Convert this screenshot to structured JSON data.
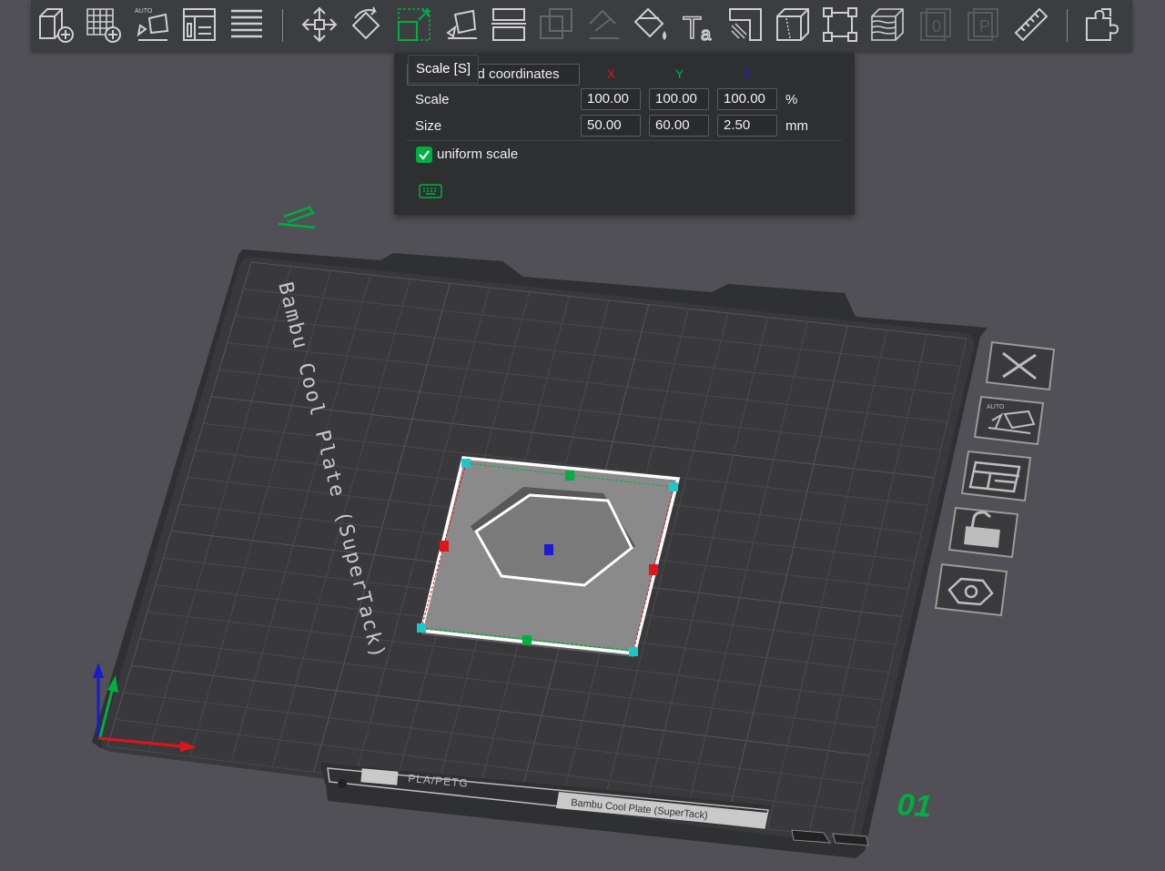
{
  "toolbar": {
    "items": [
      {
        "id": "add",
        "icon": "add-object-icon",
        "label": "Add"
      },
      {
        "id": "grid",
        "icon": "add-plate-icon",
        "label": "Add plate"
      },
      {
        "id": "auto",
        "icon": "auto-orient-icon",
        "label": "AUTO"
      },
      {
        "id": "arrange",
        "icon": "arrange-icon",
        "label": "Arrange"
      },
      {
        "id": "split",
        "icon": "split-icon",
        "label": "Split"
      },
      {
        "id": "move",
        "icon": "move-icon",
        "label": "Move"
      },
      {
        "id": "rotate",
        "icon": "rotate-icon",
        "label": "Rotate"
      },
      {
        "id": "scale",
        "icon": "scale-icon",
        "label": "Scale"
      },
      {
        "id": "lay",
        "icon": "lay-on-face-icon",
        "label": "Lay on face"
      },
      {
        "id": "cut",
        "icon": "cut-icon",
        "label": "Cut"
      },
      {
        "id": "boolean",
        "icon": "boolean-icon",
        "label": "Boolean"
      },
      {
        "id": "paint",
        "icon": "support-paint-icon",
        "label": "Support painting"
      },
      {
        "id": "color",
        "icon": "color-paint-icon",
        "label": "Color painting"
      },
      {
        "id": "text",
        "icon": "text-icon",
        "label": "Ta"
      },
      {
        "id": "seam",
        "icon": "seam-icon",
        "label": "Seam"
      },
      {
        "id": "assembly",
        "icon": "assembly-icon",
        "label": "Assembly"
      },
      {
        "id": "box",
        "icon": "bounding-box-icon",
        "label": "Bounding box"
      },
      {
        "id": "layers",
        "icon": "variable-layer-icon",
        "label": "Layers"
      },
      {
        "id": "zero",
        "icon": "zero-icon",
        "label": "0"
      },
      {
        "id": "p",
        "icon": "p-icon",
        "label": "P"
      },
      {
        "id": "measure",
        "icon": "measure-icon",
        "label": "Measure"
      },
      {
        "id": "assemble",
        "icon": "puzzle-icon",
        "label": "Assemble"
      }
    ]
  },
  "scale_panel": {
    "coord_combo": "World coordinates",
    "axes": {
      "x": "X",
      "y": "Y",
      "z": "Z"
    },
    "rows": [
      {
        "label": "Scale",
        "x": "100.00",
        "y": "100.00",
        "z": "100.00",
        "unit": "%"
      },
      {
        "label": "Size",
        "x": "50.00",
        "y": "60.00",
        "z": "2.50",
        "unit": "mm"
      }
    ],
    "uniform_label": "uniform scale",
    "uniform_checked": true
  },
  "tooltip": "Scale [S]",
  "plate": {
    "name": "Bambu Cool Plate (SuperTack)",
    "front_label_left": "PLA/PETG",
    "front_label_right": "Bambu Cool Plate (SuperTack)",
    "number": "01"
  },
  "plate_buttons": [
    {
      "id": "delete",
      "icon": "close-icon"
    },
    {
      "id": "auto",
      "icon": "auto-orient-icon",
      "label": "AUTO"
    },
    {
      "id": "arrange",
      "icon": "arrange-icon"
    },
    {
      "id": "lock",
      "icon": "lock-icon"
    },
    {
      "id": "settings",
      "icon": "hex-nut-icon"
    }
  ],
  "colors": {
    "accent": "#00ae42",
    "bg": "#505056",
    "plate": "#37373a",
    "model": "#8a8a8a",
    "axis_x": "#e0141e",
    "axis_y": "#00ae42",
    "axis_z": "#1a1ad0"
  }
}
